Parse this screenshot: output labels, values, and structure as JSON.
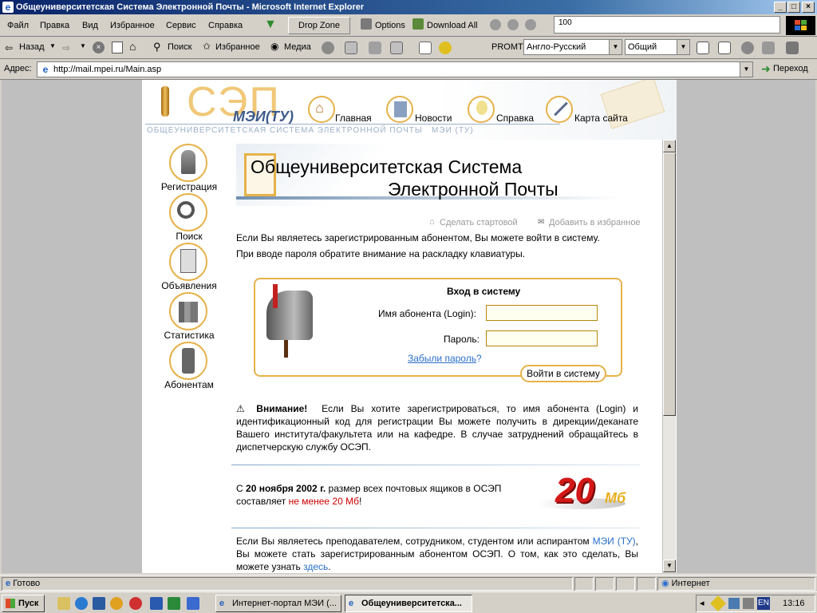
{
  "window": {
    "title": "Общеуниверситетская Система Электронной Почты - Microsoft Internet Explorer"
  },
  "menubar": {
    "items": [
      "Файл",
      "Правка",
      "Вид",
      "Избранное",
      "Сервис",
      "Справка"
    ],
    "drop_zone": "Drop Zone",
    "options": "Options",
    "download_all": "Download All",
    "zoom_field": "100"
  },
  "toolbar": {
    "back": "Назад",
    "search": "Поиск",
    "favorites": "Избранное",
    "media": "Медиа",
    "promt": "PROMT",
    "direction_select": "Англо-Русский",
    "topic_select": "Общий"
  },
  "address": {
    "label": "Адрес:",
    "url": "http://mail.mpei.ru/Main.asp",
    "go": "Переход"
  },
  "header": {
    "logo_main": "СЭП",
    "logo_sub": "МЭИ(ТУ)",
    "tagline": "ОБЩЕУНИВЕРСИТЕТСКАЯ СИСТЕМА ЭЛЕКТРОННОЙ ПОЧТЫ   МЭИ (ТУ)",
    "nav": [
      {
        "label": "Главная",
        "icon": "home-icon"
      },
      {
        "label": "Новости",
        "icon": "news-icon"
      },
      {
        "label": "Справка",
        "icon": "bulb-icon"
      },
      {
        "label": "Карта сайта",
        "icon": "compass-icon"
      }
    ]
  },
  "sidebar": {
    "items": [
      {
        "label": "Регистрация",
        "icon": "key-icon"
      },
      {
        "label": "Поиск",
        "icon": "magnifier-icon"
      },
      {
        "label": "Объявления",
        "icon": "notice-icon"
      },
      {
        "label": "Статистика",
        "icon": "stats-icon"
      },
      {
        "label": "Абонентам",
        "icon": "phone-icon"
      }
    ]
  },
  "main": {
    "banner_line1": "Общеуниверситетская Система",
    "banner_line2": "Электронной Почты",
    "make_start": "Сделать стартовой",
    "add_fav": "Добавить в избранное",
    "intro1": "Если Вы являетесь зарегистрированным абонентом, Вы можете войти в систему.",
    "intro2": "При вводе пароля обратите внимание на раскладку клавиатуры.",
    "login": {
      "title": "Вход в систему",
      "user_label": "Имя абонента (Login):",
      "user_value": "",
      "pass_label": "Пароль:",
      "pass_value": "",
      "forgot": "Забыли пароль",
      "forgot_q": "?",
      "submit": "Войти в систему"
    },
    "warning_title": "Внимание!",
    "warning_text": "Если Вы хотите зарегистрироваться, то имя абонента (Login) и идентификационный код для регистрации Вы можете получить в дирекции/деканате Вашего института/факультета или на кафедре. В случае затруднений обращайтесь в диспетчерскую службу ОСЭП.",
    "news_pre": "С",
    "news_date": "20 ноября 2002 г.",
    "news_mid": "размер всех почтовых ящиков в ОСЭП составляет",
    "news_red": "не менее 20 Мб",
    "news_end": "!",
    "badge_number": "20",
    "badge_unit": "Мб",
    "footer_pre": "Если Вы являетесь преподавателем, сотрудником, студентом или аспирантом",
    "footer_link1": "МЭИ (ТУ)",
    "footer_mid": ", Вы можете стать зарегистрированным абонентом ОСЭП. О том, как это сделать, Вы можете узнать",
    "footer_link2": "здесь",
    "footer_end": "."
  },
  "status": {
    "text": "Готово",
    "zone": "Интернет"
  },
  "taskbar": {
    "start": "Пуск",
    "tasks": [
      "Интернет-портал МЭИ (...",
      "Общеуниверситетска..."
    ],
    "lang": "EN",
    "time": "13:16"
  },
  "colors": {
    "accent": "#e6b24a",
    "title_bar": "#0a246a",
    "link": "#2a6fc9",
    "red": "#cc0000"
  }
}
